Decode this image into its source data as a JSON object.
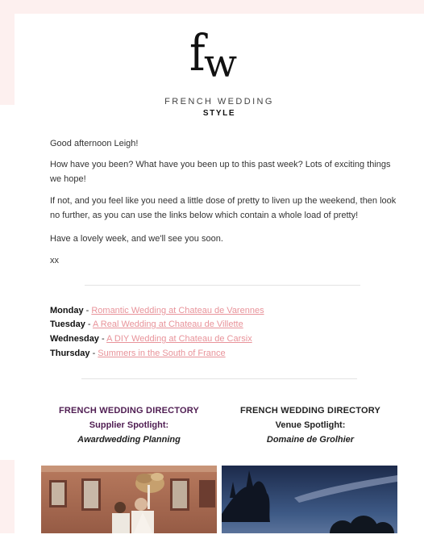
{
  "brand": {
    "logo_text": "fw",
    "line1": "FRENCH WEDDING",
    "line2": "STYLE"
  },
  "intro": {
    "greeting": "Good afternoon Leigh!",
    "p1": "How have you been? What have you been up to this past week? Lots of exciting things we hope!",
    "p2": "If not, and you feel like you need a little dose of pretty to liven up the weekend, then look no further, as you can use the links below which contain a whole load of pretty!",
    "p3": "Have a lovely week, and we'll see you soon.",
    "signoff": "xx"
  },
  "posts": [
    {
      "day": "Monday",
      "separator": " - ",
      "link": "Romantic Wedding at Chateau de Varennes"
    },
    {
      "day": "Tuesday",
      "separator": " - ",
      "link": "A Real Wedding at Chateau de Villette"
    },
    {
      "day": "Wednesday",
      "separator": " - ",
      "link": "A DIY Wedding at Chateau de Carsix"
    },
    {
      "day": "Thursday",
      "separator": " - ",
      "link": "Summers in the South of France"
    }
  ],
  "directory": [
    {
      "title": "FRENCH WEDDING DIRECTORY",
      "subtitle": "Supplier Spotlight:",
      "name": "Awardwedding Planning",
      "color": "#4f1d52"
    },
    {
      "title": "FRENCH WEDDING DIRECTORY",
      "subtitle": "Venue Spotlight:",
      "name": "Domaine de Grolhier",
      "color": "#222222"
    }
  ],
  "colors": {
    "background": "#fdf0ef",
    "link": "#e8939a",
    "accent_purple": "#4f1d52"
  },
  "icons": {
    "photo_left": "wedding-couple-photo",
    "photo_right": "venue-night-photo"
  }
}
